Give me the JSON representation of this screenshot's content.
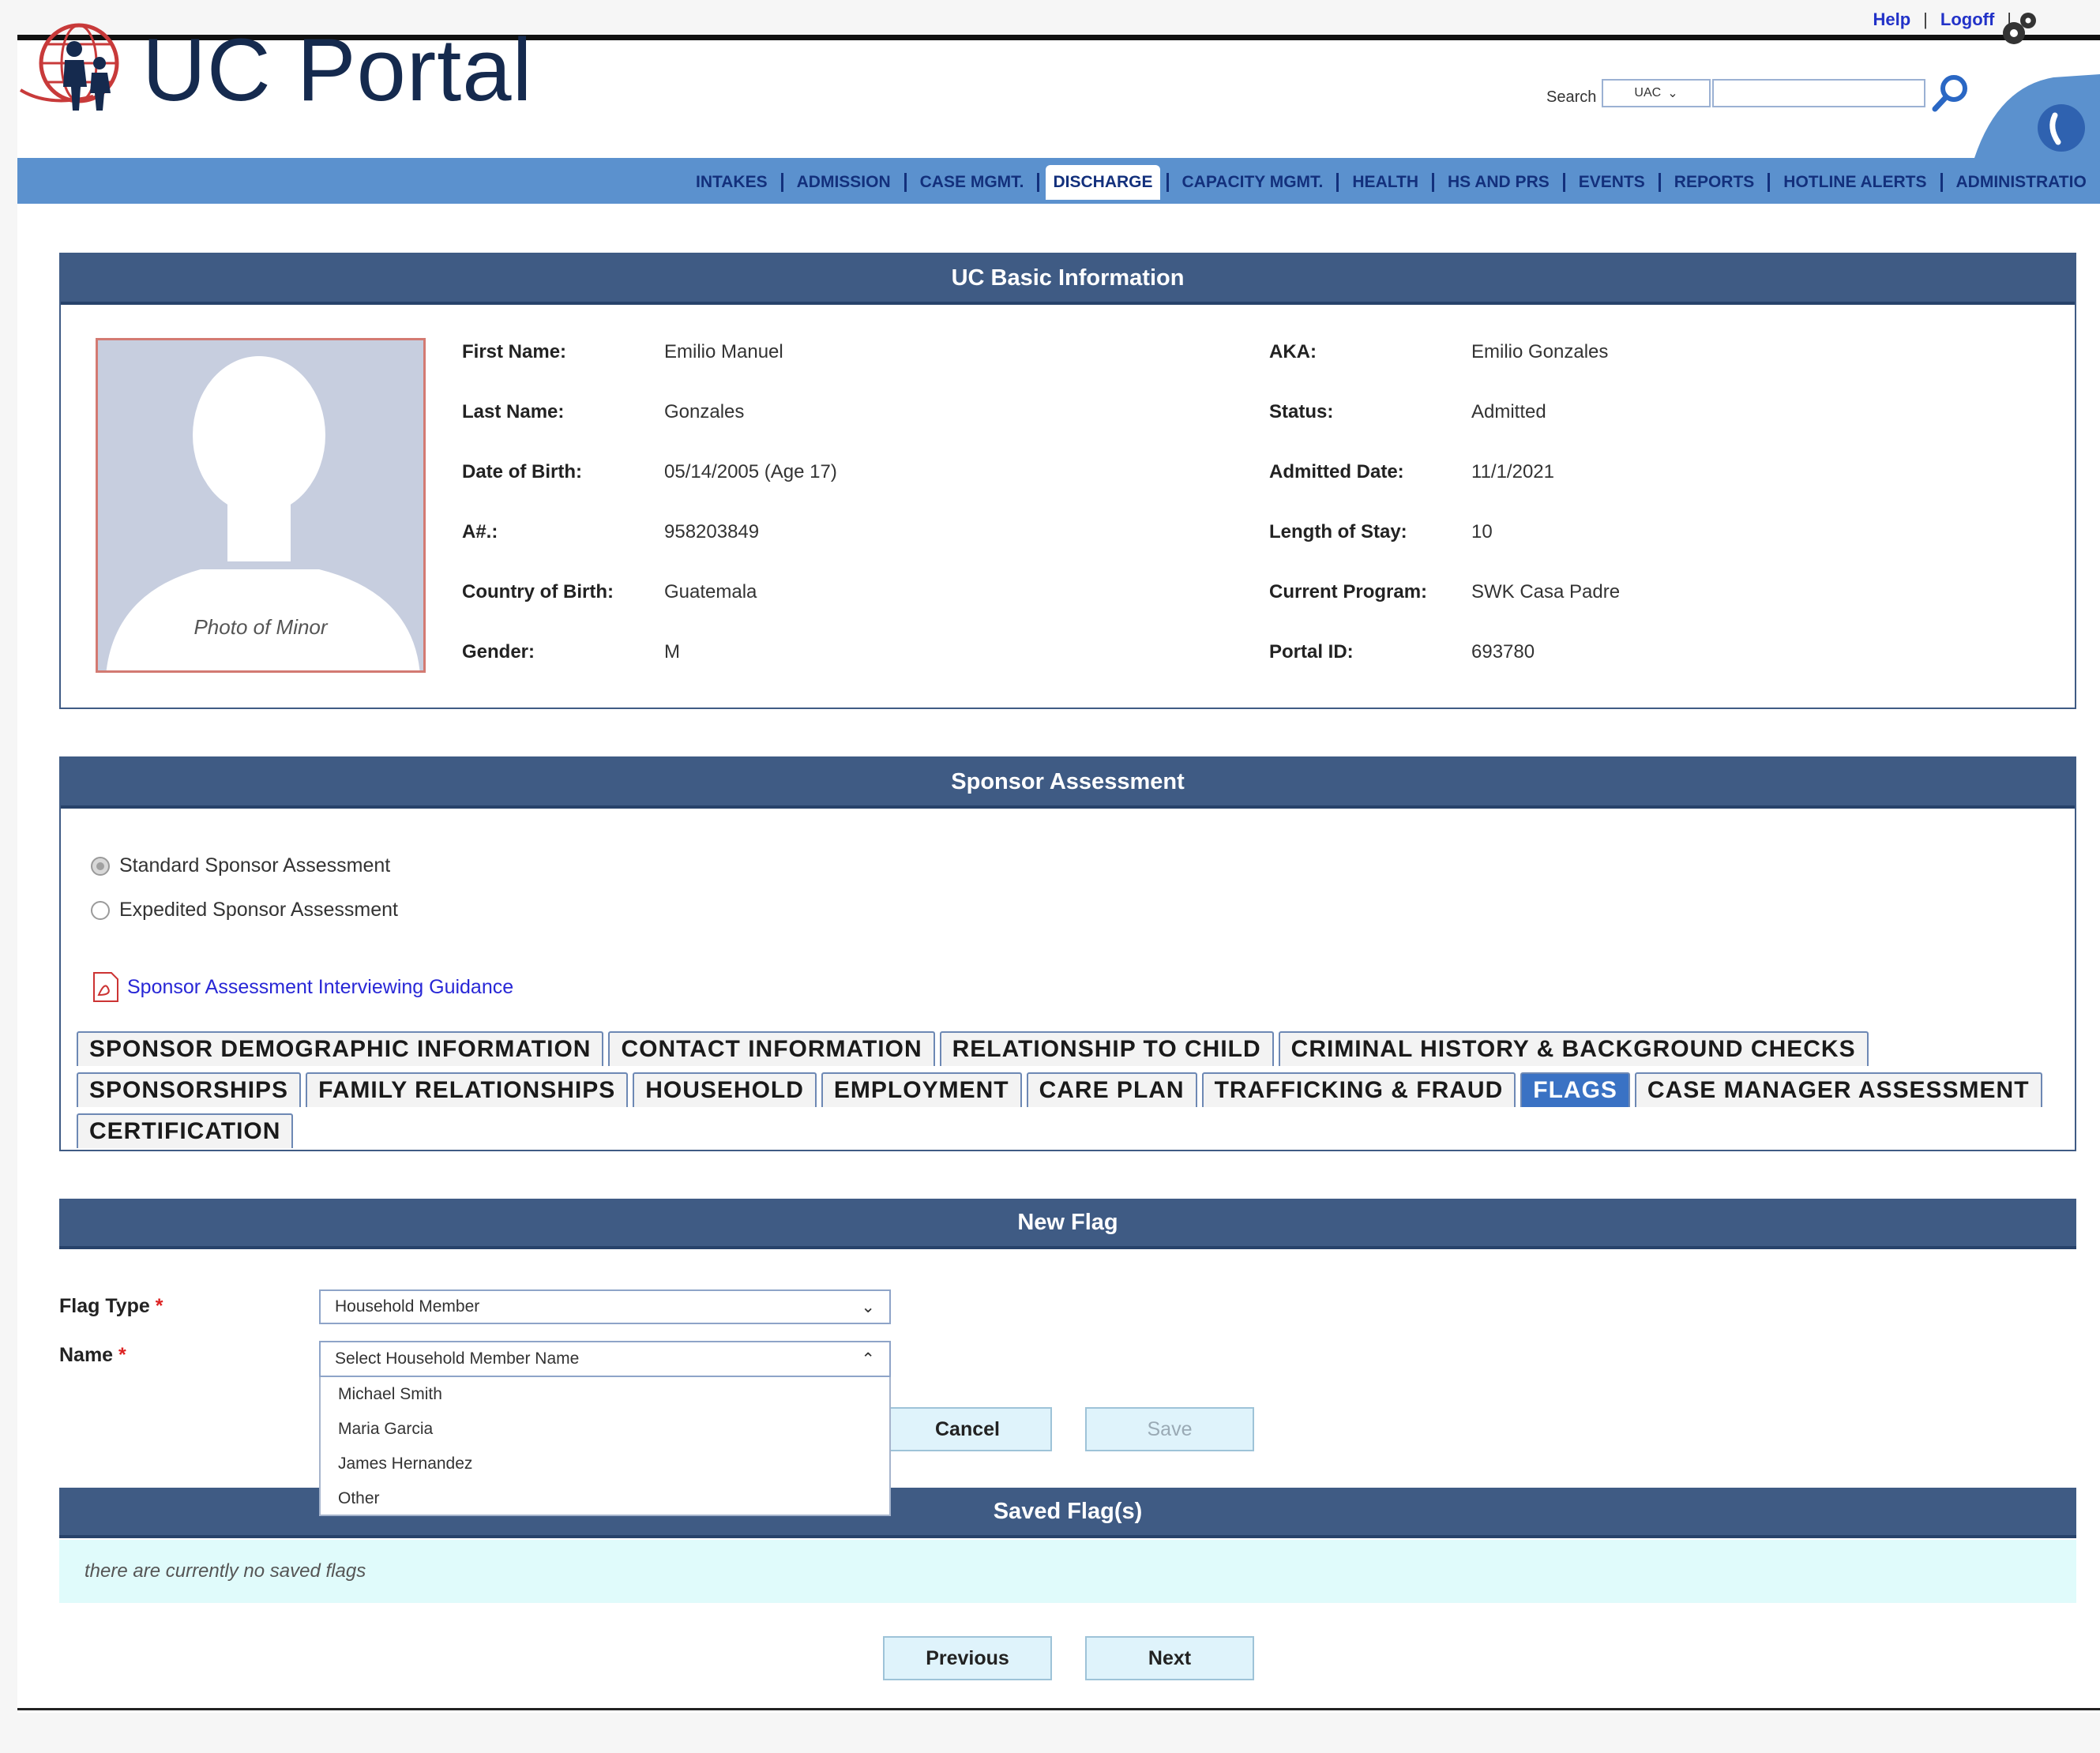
{
  "app": {
    "title": "UC Portal",
    "links": {
      "help": "Help",
      "logoff": "Logoff",
      "sep": "|"
    },
    "search": {
      "label": "Search",
      "scope": "UAC",
      "value": ""
    }
  },
  "nav": [
    {
      "label": "INTAKES",
      "active": false
    },
    {
      "label": "ADMISSION",
      "active": false
    },
    {
      "label": "CASE MGMT.",
      "active": false
    },
    {
      "label": "DISCHARGE",
      "active": true
    },
    {
      "label": "CAPACITY MGMT.",
      "active": false
    },
    {
      "label": "HEALTH",
      "active": false
    },
    {
      "label": "HS AND PRS",
      "active": false
    },
    {
      "label": "EVENTS",
      "active": false
    },
    {
      "label": "REPORTS",
      "active": false
    },
    {
      "label": "HOTLINE ALERTS",
      "active": false
    },
    {
      "label": "ADMINISTRATIO",
      "active": false
    }
  ],
  "basic_info": {
    "title": "UC Basic Information",
    "photo_caption": "Photo of Minor",
    "left": [
      {
        "label": "First Name:",
        "value": "Emilio Manuel"
      },
      {
        "label": "Last Name:",
        "value": "Gonzales"
      },
      {
        "label": "Date of Birth:",
        "value": "05/14/2005 (Age 17)"
      },
      {
        "label": "A#.:",
        "value": "958203849"
      },
      {
        "label": "Country of Birth:",
        "value": "Guatemala"
      },
      {
        "label": "Gender:",
        "value": "M"
      }
    ],
    "right": [
      {
        "label": "AKA:",
        "value": "Emilio Gonzales"
      },
      {
        "label": "Status:",
        "value": "Admitted"
      },
      {
        "label": "Admitted Date:",
        "value": "11/1/2021"
      },
      {
        "label": "Length of Stay:",
        "value": "10"
      },
      {
        "label": "Current Program:",
        "value": "SWK Casa Padre"
      },
      {
        "label": "Portal ID:",
        "value": "693780"
      }
    ]
  },
  "sponsor": {
    "title": "Sponsor Assessment",
    "options": [
      {
        "label": "Standard Sponsor Assessment",
        "checked": true
      },
      {
        "label": "Expedited Sponsor Assessment",
        "checked": false
      }
    ],
    "guidance_link": "Sponsor Assessment Interviewing Guidance",
    "tabs_row1": [
      {
        "label": "SPONSOR DEMOGRAPHIC INFORMATION",
        "active": false
      },
      {
        "label": "CONTACT INFORMATION",
        "active": false
      },
      {
        "label": "RELATIONSHIP TO CHILD",
        "active": false
      },
      {
        "label": "CRIMINAL HISTORY & BACKGROUND CHECKS",
        "active": false
      }
    ],
    "tabs_row2": [
      {
        "label": "SPONSORSHIPS",
        "active": false
      },
      {
        "label": "FAMILY RELATIONSHIPS",
        "active": false
      },
      {
        "label": "HOUSEHOLD",
        "active": false
      },
      {
        "label": "EMPLOYMENT",
        "active": false
      },
      {
        "label": "CARE PLAN",
        "active": false
      },
      {
        "label": "TRAFFICKING & FRAUD",
        "active": false
      },
      {
        "label": "FLAGS",
        "active": true
      },
      {
        "label": "CASE MANAGER ASSESSMENT",
        "active": false
      }
    ],
    "tabs_row3": [
      {
        "label": "CERTIFICATION",
        "active": false
      }
    ]
  },
  "new_flag": {
    "title": "New Flag",
    "flag_type_label": "Flag Type",
    "flag_type_value": "Household Member",
    "name_label": "Name",
    "required_mark": "*",
    "name_placeholder": "Select Household Member Name",
    "name_options": [
      "Michael Smith",
      "Maria Garcia",
      "James Hernandez",
      "Other"
    ],
    "cancel_label": "Cancel",
    "save_label": "Save"
  },
  "saved_flags": {
    "title": "Saved Flag(s)",
    "empty_text": "there are currently no saved flags"
  },
  "footer": {
    "previous_label": "Previous",
    "next_label": "Next"
  },
  "colors": {
    "header_navy": "#3f5b84",
    "nav_blue": "#5b91ce",
    "active_tab": "#3a72c4",
    "link": "#2827d6"
  }
}
